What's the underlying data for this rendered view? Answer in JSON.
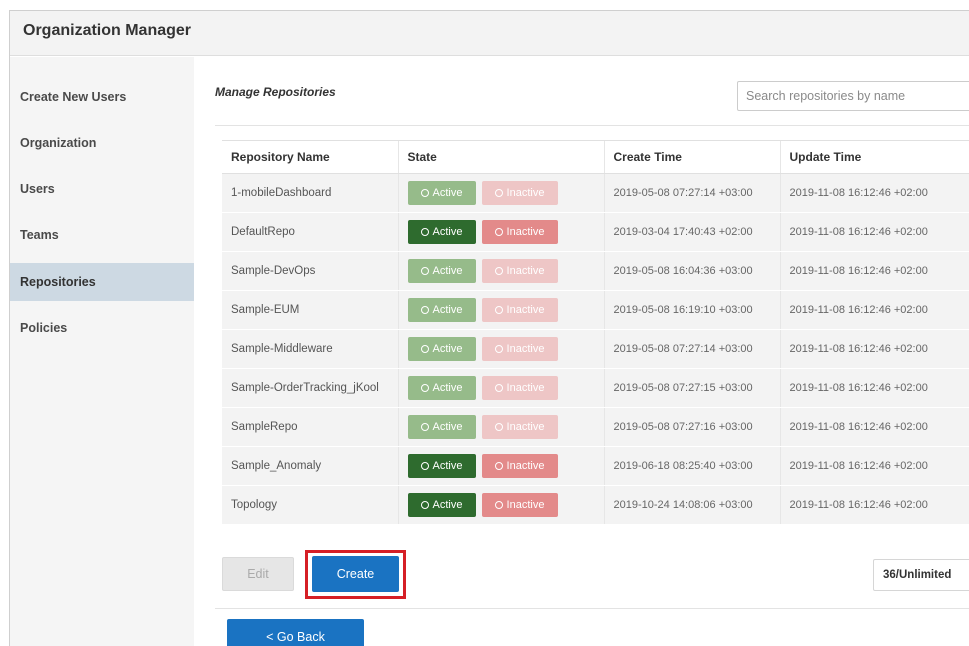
{
  "app": {
    "title": "Organization Manager"
  },
  "sidebar": {
    "items": [
      {
        "label": "Create New Users",
        "active": false
      },
      {
        "label": "Organization",
        "active": false
      },
      {
        "label": "Users",
        "active": false
      },
      {
        "label": "Teams",
        "active": false
      },
      {
        "label": "Repositories",
        "active": true
      },
      {
        "label": "Policies",
        "active": false
      }
    ]
  },
  "main": {
    "section_title": "Manage Repositories",
    "search": {
      "placeholder": "Search repositories by name",
      "value": ""
    }
  },
  "table": {
    "headers": [
      "Repository Name",
      "State",
      "Create Time",
      "Update Time"
    ],
    "active_label": "Active",
    "inactive_label": "Inactive",
    "rows": [
      {
        "name": "1-mobileDashboard",
        "state": "active",
        "create_time": "2019-05-08 07:27:14 +03:00",
        "update_time": "2019-11-08 16:12:46 +02:00"
      },
      {
        "name": "DefaultRepo",
        "state": "both-enabled",
        "create_time": "2019-03-04 17:40:43 +02:00",
        "update_time": "2019-11-08 16:12:46 +02:00"
      },
      {
        "name": "Sample-DevOps",
        "state": "active",
        "create_time": "2019-05-08 16:04:36 +03:00",
        "update_time": "2019-11-08 16:12:46 +02:00"
      },
      {
        "name": "Sample-EUM",
        "state": "active",
        "create_time": "2019-05-08 16:19:10 +03:00",
        "update_time": "2019-11-08 16:12:46 +02:00"
      },
      {
        "name": "Sample-Middleware",
        "state": "active",
        "create_time": "2019-05-08 07:27:14 +03:00",
        "update_time": "2019-11-08 16:12:46 +02:00"
      },
      {
        "name": "Sample-OrderTracking_jKool",
        "state": "active",
        "create_time": "2019-05-08 07:27:15 +03:00",
        "update_time": "2019-11-08 16:12:46 +02:00"
      },
      {
        "name": "SampleRepo",
        "state": "active",
        "create_time": "2019-05-08 07:27:16 +03:00",
        "update_time": "2019-11-08 16:12:46 +02:00"
      },
      {
        "name": "Sample_Anomaly",
        "state": "both-enabled",
        "create_time": "2019-06-18 08:25:40 +03:00",
        "update_time": "2019-11-08 16:12:46 +02:00"
      },
      {
        "name": "Topology",
        "state": "both-enabled",
        "create_time": "2019-10-24 14:08:06 +03:00",
        "update_time": "2019-11-08 16:12:46 +02:00"
      }
    ]
  },
  "footer": {
    "edit_label": "Edit",
    "create_label": "Create",
    "quota": "36/Unlimited",
    "back_label": "< Go Back"
  },
  "colors": {
    "primary_button": "#1a73c2",
    "active_button": "#2e6b2e",
    "inactive_button": "#e38a8a",
    "highlight": "#d51f26",
    "sidebar_active": "#cdd9e3"
  },
  "icons": {
    "state_button_icon": "circle-icon"
  }
}
